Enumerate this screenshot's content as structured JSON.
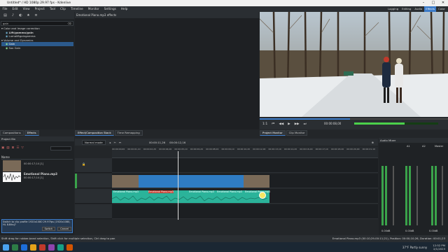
{
  "window": {
    "title": "Untitled* / HD 1080p 29.97 fps - Kdenlive"
  },
  "menu": [
    "File",
    "Edit",
    "View",
    "Project",
    "Tool",
    "Clip",
    "Timeline",
    "Monitor",
    "Settings",
    "Help"
  ],
  "layouts": [
    "Logging",
    "Editing",
    "Audio",
    "Effects",
    "Color"
  ],
  "active_layout": "Effects",
  "effects_panel": {
    "search_value": "gain",
    "tree": [
      {
        "label": "Color and Image correction",
        "level": 0
      },
      {
        "label": "Lift/gamma/gain",
        "level": 1,
        "bold": true
      },
      {
        "label": "Lumaliftgaingamma",
        "level": 1
      },
      {
        "label": "Volume and Dynamics",
        "level": 0
      },
      {
        "label": "Gain",
        "level": 1,
        "selected": true
      },
      {
        "label": "Sox Gain",
        "level": 1
      }
    ],
    "tabs": [
      "Compositions",
      "Effects"
    ]
  },
  "effect_stack": {
    "title": "Emotional Piano.mp3 effects",
    "tabs": [
      "Effect/Composition Stack",
      "Time Remapping"
    ]
  },
  "monitor": {
    "tabs": [
      "Project Monitor",
      "Clip Monitor"
    ],
    "zoom": "1:1",
    "timecode": "00:00:08,00"
  },
  "project_bin": {
    "title": "Project Bin",
    "column": "Name",
    "items": [
      {
        "name": "",
        "duration": "00:00:17;14 [1]"
      },
      {
        "name": "Emotional Piano.mp3",
        "duration": "00:00:17;14 [1]"
      }
    ],
    "notice": "Switch to clip profile 1920x1080 29.97fps (1920x1080, HL 8-Bits)?",
    "switch_label": "Switch",
    "cancel_label": "Cancel"
  },
  "timeline": {
    "mode": "Normal mode",
    "timecode": "00:00:11,26",
    "duration": "00:00:12,16",
    "ticks": [
      "00:00:00,00",
      "00:00:01,10",
      "00:00:02,20",
      "00:00:04,00",
      "00:00:05,10",
      "00:00:06,20",
      "00:00:08,00",
      "00:00:09,10",
      "00:00:10,20",
      "00:00:12,00",
      "00:00:13,10",
      "00:00:14,20",
      "00:00:16,00",
      "00:00:17,10",
      "00:00:18,20",
      "00:00:20,00",
      "00:00:21,10"
    ],
    "clips": {
      "video": "",
      "audio": [
        "Emotional Piano.mp3",
        "Emotional Piano.mp3",
        "Emotional Piano.mp3",
        "Emotional Piano.mp3",
        "Emotional Piano.mp3"
      ]
    }
  },
  "mixer": {
    "title": "Audio Mixer",
    "channels": [
      "A1",
      "A2",
      "Master"
    ],
    "values": [
      "0.00dB",
      "0.00dB",
      "0.00dB"
    ]
  },
  "status": {
    "hint": "Shift drag for rubber-band selection, Shift click for multiple selection, Ctrl drag to pan",
    "clip_info": "Emotional Piano.mp3 (00:10;29-00:11;21), Position: 00:00;10;26, Duration: 00:01;23"
  },
  "taskbar": {
    "weather": "37°F  Partly sunny",
    "time": "12:52 PM",
    "date": "2/1/2023"
  },
  "colors": {
    "accent": "#3d7cc9",
    "audio_clip": "#2bb39a",
    "video_clip": "#2f7cc4",
    "green_track": "#3aa34a"
  }
}
